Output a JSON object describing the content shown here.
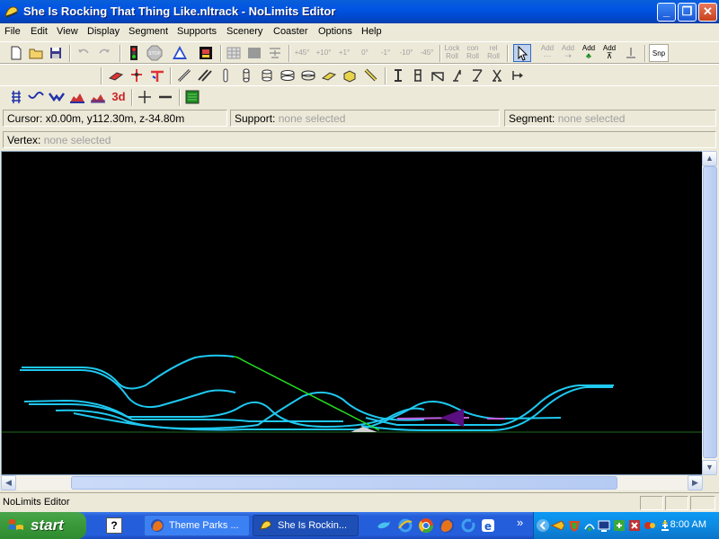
{
  "window": {
    "title": "She Is Rocking That Thing Like.nltrack - NoLimits Editor",
    "minimize": "_",
    "maximize": "❐",
    "close": "✕"
  },
  "menu": [
    "File",
    "Edit",
    "View",
    "Display",
    "Segment",
    "Supports",
    "Scenery",
    "Coaster",
    "Options",
    "Help"
  ],
  "toolbar1": {
    "rotate_buttons": [
      "+45°",
      "+10°",
      "+1°",
      "0°",
      "-1°",
      "-10°",
      "-45°"
    ],
    "lock_roll": [
      "Lock",
      "Roll"
    ],
    "con_roll": [
      "con",
      "Roll"
    ],
    "rel_roll": [
      "rel",
      "Roll"
    ],
    "add_buttons": [
      [
        "Add",
        ""
      ],
      [
        "Add",
        ""
      ],
      [
        "Add",
        ""
      ],
      [
        "Add",
        ""
      ]
    ],
    "snap": "Snp"
  },
  "toolbar3": {
    "threed_label": "3d"
  },
  "info": {
    "cursor_label": "Cursor:",
    "cursor_value": "x0.00m, y112.30m, z-34.80m",
    "support_label": "Support:",
    "support_value": "none selected",
    "segment_label": "Segment:",
    "segment_value": "none selected",
    "vertex_label": "Vertex:",
    "vertex_value": "none selected"
  },
  "colors": {
    "track": "#1ec8f0",
    "selected_segment": "#22e022",
    "ground_line": "#1e6e1e",
    "station_marker": "#6a1a8a",
    "viewport_bg": "#000000"
  },
  "status": {
    "text": "NoLimits Editor"
  },
  "taskbar": {
    "start_label": "start",
    "tasks": [
      {
        "label": "Theme Parks ...",
        "icon": "firefox-icon"
      },
      {
        "label": "She Is Rockin...",
        "icon": "nolimits-icon"
      }
    ],
    "show_more": "»",
    "clock": "8:00 AM"
  }
}
